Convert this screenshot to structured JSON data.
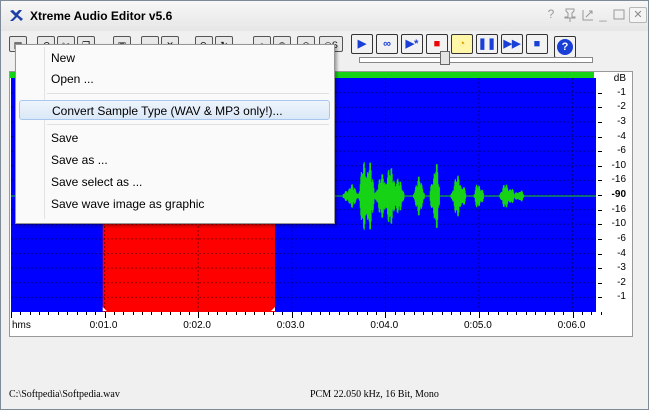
{
  "window": {
    "title": "Xtreme Audio Editor v5.6",
    "controls": [
      "?",
      "pin",
      "minimize",
      "maximize",
      "close"
    ]
  },
  "toolbar": {
    "edit_buttons": [
      "file-icon",
      "undo-icon",
      "cut-icon",
      "copy-icon",
      "paste-icon",
      "crop-icon",
      "delete-icon",
      "redo-icon",
      "zoom-in-icon",
      "zoom-out-icon",
      "zoom-all-icon",
      "zoom-sel-icon",
      "silence-icon"
    ],
    "play_buttons": [
      {
        "name": "play-button",
        "glyph": "▶"
      },
      {
        "name": "loop-button",
        "glyph": "∞"
      },
      {
        "name": "play-from-cursor-button",
        "glyph": "▶*"
      },
      {
        "name": "record-button",
        "glyph": "■"
      },
      {
        "name": "meter-button",
        "glyph": "◔"
      },
      {
        "name": "pause-button",
        "glyph": "❚❚"
      },
      {
        "name": "play-selection-button",
        "glyph": "▶▶"
      },
      {
        "name": "stop-button",
        "glyph": "■"
      }
    ],
    "help_label": "?",
    "volume_level": 0.37
  },
  "file_menu": {
    "items": [
      {
        "label": "New",
        "highlighted": false
      },
      {
        "label": "Open ...",
        "highlighted": false
      },
      {
        "label": "Convert Sample Type (WAV & MP3 only!)...",
        "highlighted": true
      },
      {
        "label": "Save",
        "highlighted": false
      },
      {
        "label": "Save as ...",
        "highlighted": false
      },
      {
        "label": "Save select as ...",
        "highlighted": false
      },
      {
        "label": "Save wave image as graphic",
        "highlighted": false
      }
    ]
  },
  "waveform": {
    "background_color": "#0000ff",
    "wave_color": "#16d316",
    "selection_color": "#ff0000",
    "selection_start_s": 0.98,
    "selection_end_s": 2.82,
    "duration_visible_s": 6.25
  },
  "db_scale": {
    "unit": "dB",
    "labels": [
      "-1",
      "-2",
      "-3",
      "-4",
      "-6",
      "-10",
      "-16",
      "-90",
      "-16",
      "-10",
      "-6",
      "-4",
      "-3",
      "-2",
      "-1"
    ]
  },
  "timeline": {
    "unit": "hms",
    "ticks": [
      "0:01.0",
      "0:02.0",
      "0:03.0",
      "0:04.0",
      "0:05.0",
      "0:06.0"
    ]
  },
  "status": {
    "file": "C:\\Softpedia\\Softpedia.wav",
    "format": "PCM 22.050 kHz, 16 Bit, Mono"
  }
}
